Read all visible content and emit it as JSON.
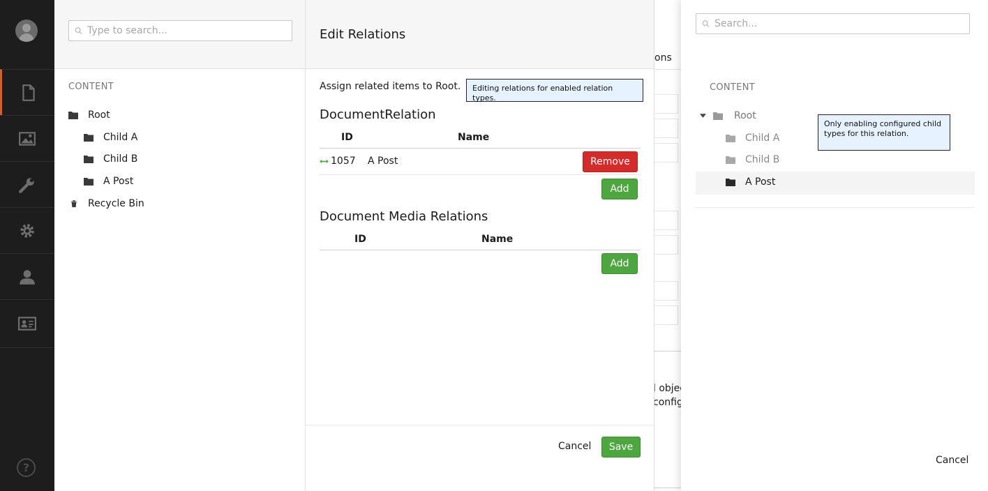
{
  "sidebar": {
    "items": [
      {
        "icon": "document-icon"
      },
      {
        "icon": "image-icon"
      },
      {
        "icon": "wrench-icon"
      },
      {
        "icon": "gear-icon"
      },
      {
        "icon": "user-icon"
      },
      {
        "icon": "id-card-icon"
      }
    ],
    "help_label": "?"
  },
  "tree_panel": {
    "search_placeholder": "Type to search...",
    "section_title": "CONTENT",
    "root": "Root",
    "children": [
      "Child A",
      "Child B",
      "A Post"
    ],
    "recycle_bin": "Recycle Bin"
  },
  "edit_panel": {
    "title": "Edit Relations",
    "assign_text": "Assign related items to Root.",
    "tooltip": "Editing relations for enabled relation types.",
    "document_relation": {
      "heading": "DocumentRelation",
      "col_id": "ID",
      "col_name": "Name",
      "rows": [
        {
          "id": "1057",
          "name": "A Post"
        }
      ],
      "remove_label": "Remove",
      "add_label": "Add"
    },
    "media_relations": {
      "heading": "Document Media Relations",
      "col_id": "ID",
      "col_name": "Name",
      "add_label": "Add"
    },
    "cancel_label": "Cancel",
    "save_label": "Save"
  },
  "background": {
    "tab_fragment": "ons",
    "text_fragment_1": "l objec",
    "text_fragment_2": "config"
  },
  "picker_panel": {
    "search_placeholder": "Search...",
    "section_title": "CONTENT",
    "root": "Root",
    "children": [
      "Child A",
      "Child B",
      "A Post"
    ],
    "selected_child": "A Post",
    "tooltip": "Only enabling configured child types for this relation.",
    "cancel_label": "Cancel"
  },
  "colors": {
    "accent": "#c9622f",
    "success": "#4ea640",
    "danger": "#d42b2b",
    "tooltip_bg": "#e6f2ff",
    "sidebar_bg": "#1d1d1d"
  }
}
